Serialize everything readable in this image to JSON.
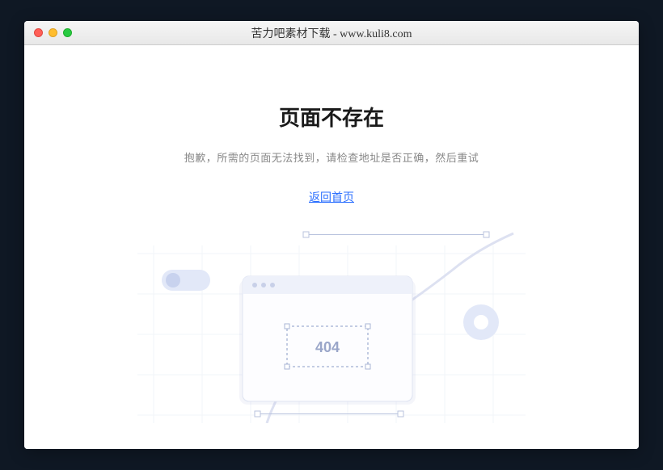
{
  "window": {
    "title": "苦力吧素材下载 - www.kuli8.com"
  },
  "error": {
    "heading": "页面不存在",
    "subtext": "抱歉，所需的页面无法找到，请检查地址是否正确，然后重试",
    "home_link": "返回首页",
    "code": "404"
  }
}
